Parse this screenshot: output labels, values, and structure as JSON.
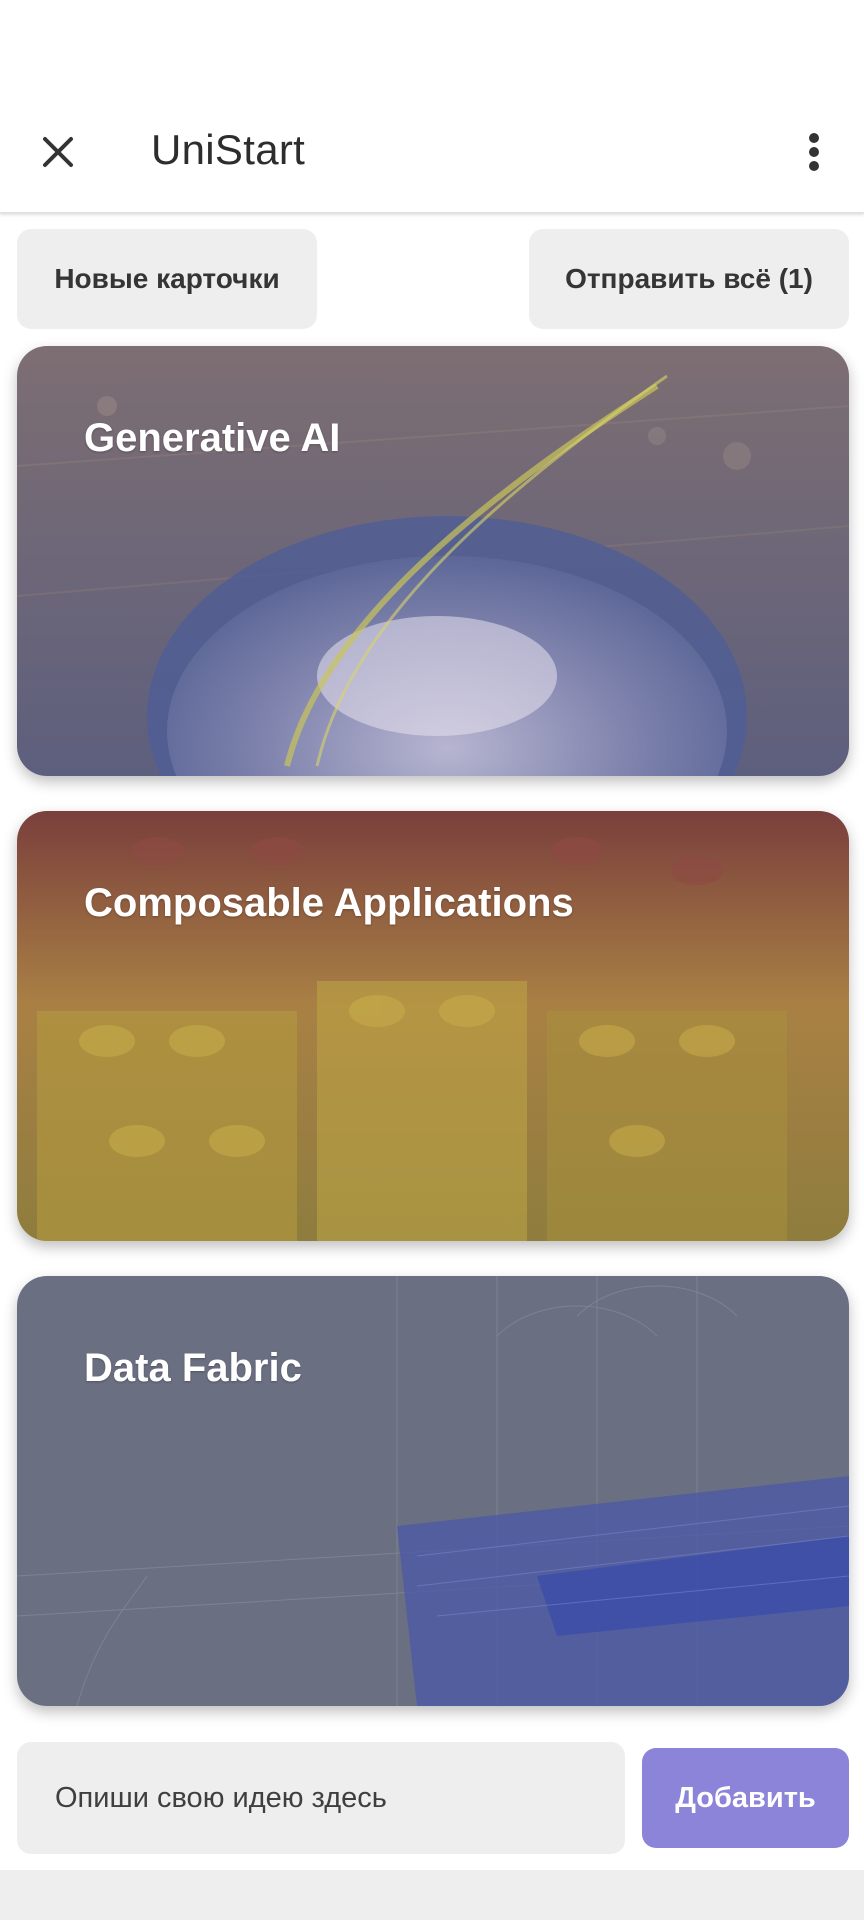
{
  "app_bar": {
    "title": "UniStart",
    "close_icon": "close-icon",
    "more_icon": "more-vertical-icon"
  },
  "actions": {
    "new_cards_label": "Новые карточки",
    "send_all_label": "Отправить всё (1)"
  },
  "cards": [
    {
      "title": "Generative AI",
      "image": "bowl-with-glowing-swirl"
    },
    {
      "title": "Composable Applications",
      "image": "yellow-lego-bricks"
    },
    {
      "title": "Data Fabric",
      "image": "blue-wireframe-structure"
    }
  ],
  "composer": {
    "placeholder": "Опиши свою идею здесь",
    "add_label": "Добавить"
  },
  "colors": {
    "accent": "#8b84d8",
    "button_bg": "#eeeeee",
    "card1_tint": "#6e6e86",
    "card2_tint": "#8f6a4a",
    "card3_tint": "#6b6f82"
  }
}
